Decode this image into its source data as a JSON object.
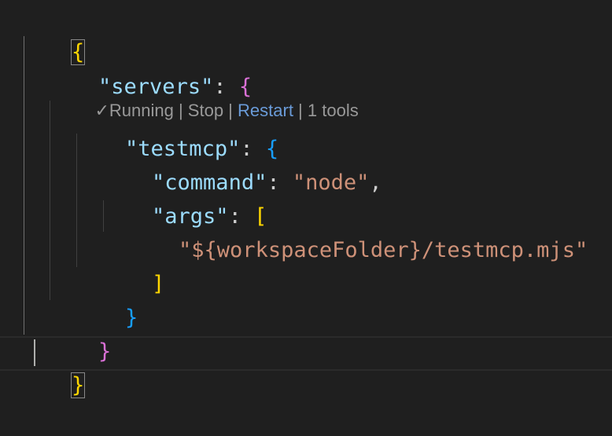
{
  "editor": {
    "lines": {
      "l1": {
        "open": "{"
      },
      "l2": {
        "key": "\"servers\"",
        "colon": ": ",
        "open": "{"
      },
      "l3": {
        "key": "\"testmcp\"",
        "colon": ": ",
        "open": "{"
      },
      "l4": {
        "key": "\"command\"",
        "colon": ": ",
        "value": "\"node\"",
        "comma": ","
      },
      "l5": {
        "key": "\"args\"",
        "colon": ": ",
        "open": "["
      },
      "l6": {
        "value": "\"${workspaceFolder}/testmcp.mjs\""
      },
      "l7": {
        "close": "]"
      },
      "l8": {
        "close": "}"
      },
      "l9": {
        "close": "}"
      },
      "l10": {
        "close": "}"
      }
    },
    "codelens": {
      "check": "✓",
      "running": "Running",
      "sep": " | ",
      "stop": "Stop",
      "restart": "Restart",
      "tools": "1 tools"
    }
  },
  "colors": {
    "background": "#1f1f1f",
    "key": "#9cdcfe",
    "string": "#ce9178",
    "brace_level1": "#ffd700",
    "brace_level2": "#da70d6",
    "brace_level3": "#179fff",
    "link": "#6a9bd8"
  }
}
